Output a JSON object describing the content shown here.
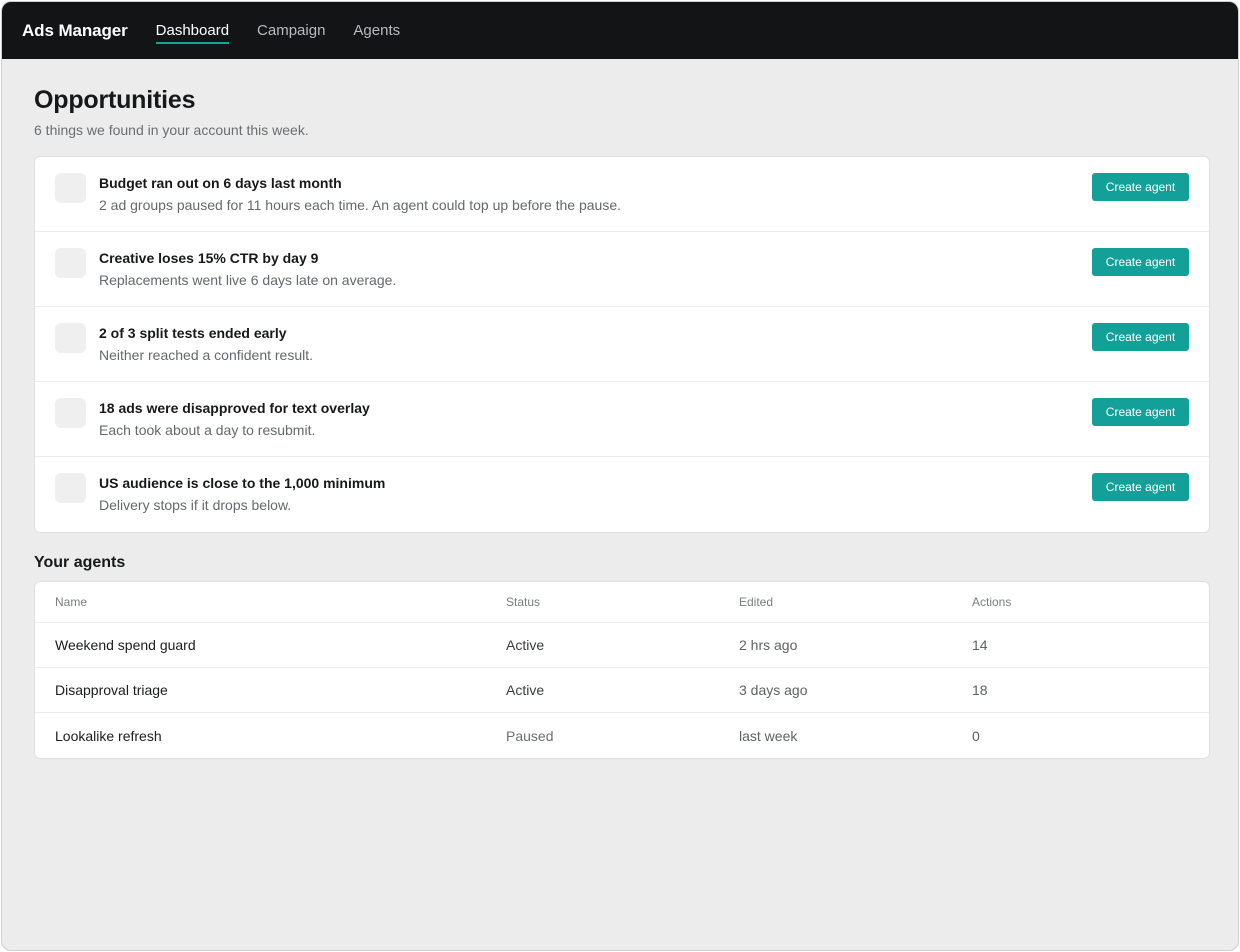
{
  "app": {
    "title": "Ads Manager"
  },
  "nav": {
    "items": [
      {
        "label": "Dashboard",
        "active": true
      },
      {
        "label": "Campaign",
        "active": false
      },
      {
        "label": "Agents",
        "active": false
      }
    ]
  },
  "opportunities": {
    "title": "Opportunities",
    "subtitle": "6 things we found in your account this week.",
    "button_label": "Create agent",
    "items": [
      {
        "title": "Budget ran out on 6 days last month",
        "description": "2 ad groups paused for 11 hours each time. An agent could top up before the pause."
      },
      {
        "title": "Creative loses 15% CTR by day 9",
        "description": "Replacements went live 6 days late on average."
      },
      {
        "title": "2 of 3 split tests ended early",
        "description": "Neither reached a confident result."
      },
      {
        "title": "18 ads were disapproved for text overlay",
        "description": "Each took about a day to resubmit."
      },
      {
        "title": "US audience is close to the 1,000 minimum",
        "description": "Delivery stops if it drops below."
      }
    ]
  },
  "agents": {
    "title": "Your agents",
    "columns": [
      "Name",
      "Status",
      "Edited",
      "Actions"
    ],
    "rows": [
      {
        "name": "Weekend spend guard",
        "status": "Active",
        "edited": "2 hrs ago",
        "actions": "14"
      },
      {
        "name": "Disapproval triage",
        "status": "Active",
        "edited": "3 days ago",
        "actions": "18"
      },
      {
        "name": "Lookalike refresh",
        "status": "Paused",
        "edited": "last week",
        "actions": "0"
      }
    ]
  },
  "colors": {
    "accent": "#12a098",
    "topbar": "#131415",
    "background": "#ececec"
  }
}
